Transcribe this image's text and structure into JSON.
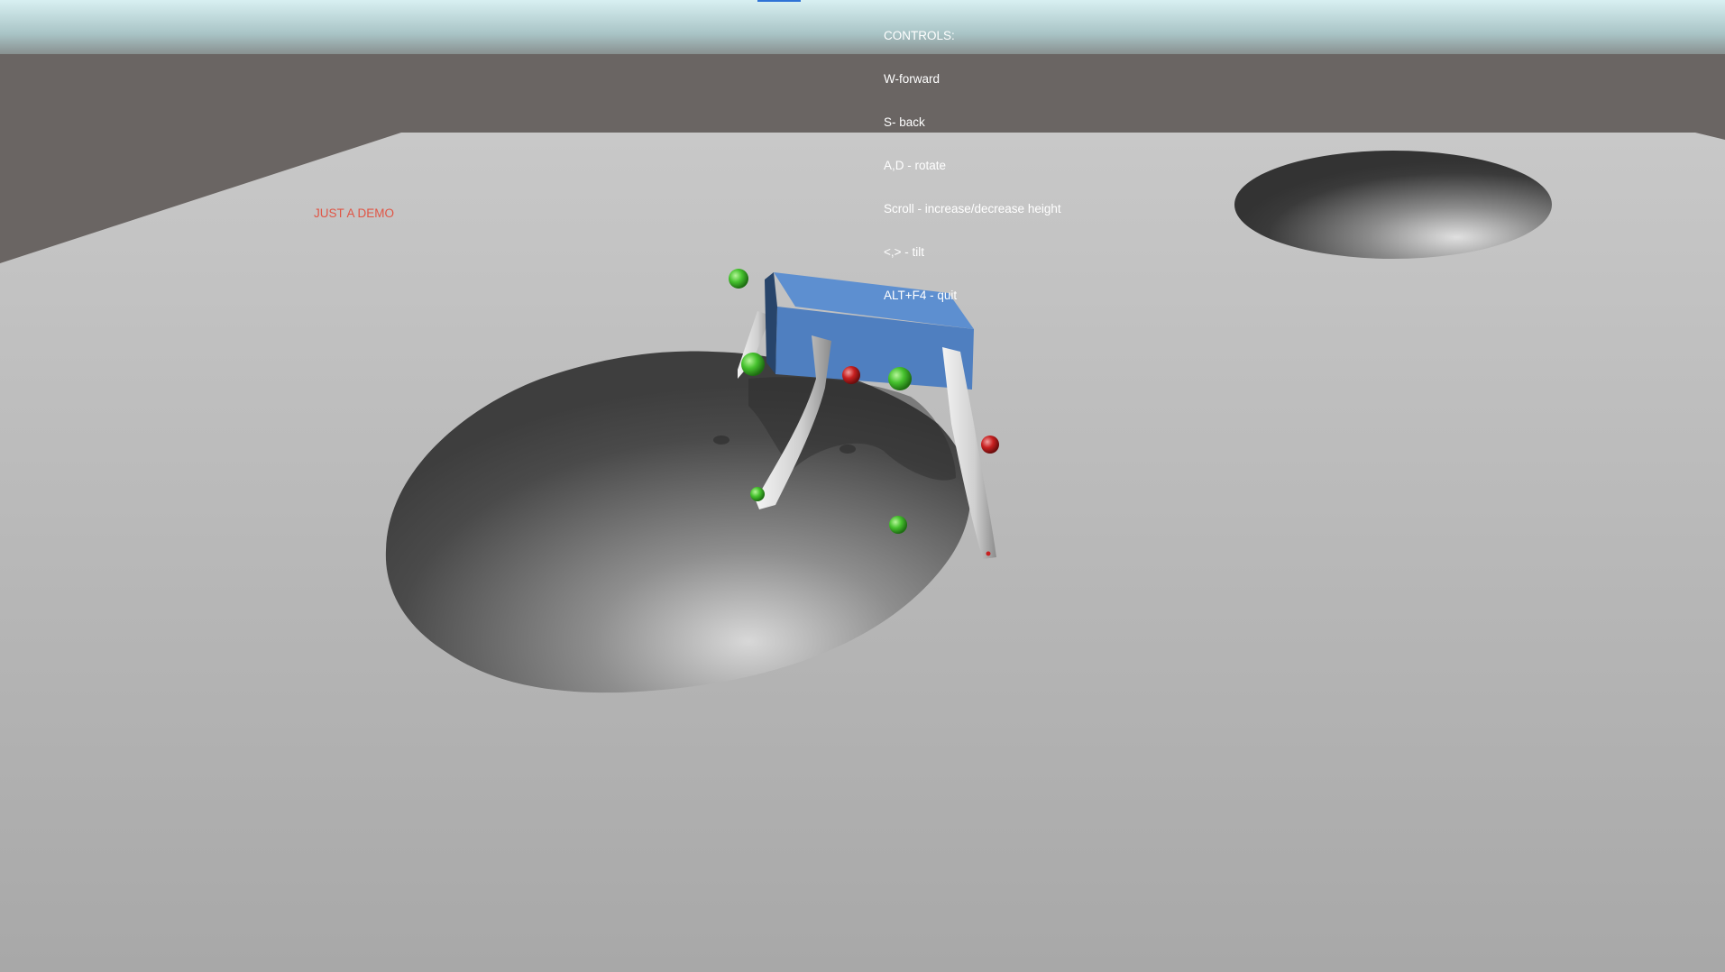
{
  "controls": {
    "title": "CONTROLS:",
    "lines": [
      "W-forward",
      "S- back",
      "A,D - rotate",
      "Scroll - increase/decrease height",
      "<,> - tilt",
      "ALT+F4 - quit"
    ]
  },
  "demo_label": "JUST A DEMO",
  "colors": {
    "sky": "#bfe2e6",
    "wall": "#6a6563",
    "floor": "#b5b5b5",
    "robot_body": "#4f7fc0",
    "target_marker": "#3fbf2f",
    "contact_marker": "#c82020",
    "demo_label": "#e05545",
    "top_bar": "#2f73d6"
  },
  "icons": [
    "hexapod-robot",
    "green-sphere-marker",
    "red-sphere-marker",
    "terrain-dome"
  ]
}
